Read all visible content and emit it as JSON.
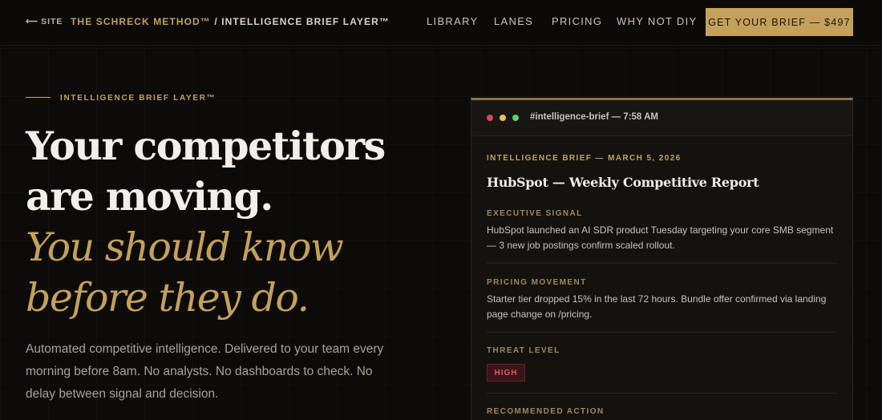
{
  "header": {
    "back_label": "SITE",
    "brand_name": "THE SCHRECK METHOD™",
    "brand_separator": "/",
    "brand_product": "INTELLIGENCE BRIEF LAYER™",
    "nav": [
      "LIBRARY",
      "LANES",
      "PRICING",
      "WHY NOT DIY"
    ],
    "cta_label": "GET YOUR BRIEF — $497"
  },
  "hero": {
    "eyebrow": "INTELLIGENCE BRIEF LAYER™",
    "headline": "Your competitors are moving.",
    "headline_italic": "You should know before they do.",
    "subtext": "Automated competitive intelligence. Delivered to your team every morning before 8am. No analysts. No dashboards to check. No delay between signal and decision."
  },
  "brief_card": {
    "channel": "#intelligence-brief — 7:58 AM",
    "date_label": "INTELLIGENCE BRIEF — MARCH 5, 2026",
    "title": "HubSpot — Weekly Competitive Report",
    "sections": [
      {
        "label": "EXECUTIVE SIGNAL",
        "text": "HubSpot launched an AI SDR product Tuesday targeting your core SMB segment — 3 new job postings confirm scaled rollout."
      },
      {
        "label": "PRICING MOVEMENT",
        "text": "Starter tier dropped 15% in the last 72 hours. Bundle offer confirmed via landing page change on /pricing."
      },
      {
        "label": "THREAT LEVEL",
        "badge": "HIGH"
      },
      {
        "label": "RECOMMENDED ACTION"
      }
    ]
  },
  "colors": {
    "background": "#0d0b0a",
    "accent_gold": "#c4a15b",
    "threat_red": "#e2555f",
    "window_dot_red": "#e0445a",
    "window_dot_yellow": "#e8c44a",
    "window_dot_green": "#5fcf6a"
  },
  "icons": {
    "back": "arrow-left-icon"
  }
}
